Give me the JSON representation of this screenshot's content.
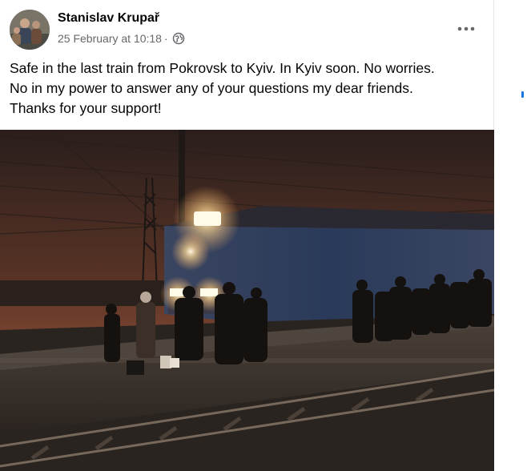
{
  "post": {
    "author": "Stanislav Krupař",
    "date": "25 February at 10:18",
    "separator": "·",
    "privacy_icon": "globe-icon",
    "more_icon": "more-options-icon",
    "text_lines": [
      "Safe in the last train from Pokrovsk to Kyiv. In Kyiv soon. No worries.",
      "No in my power to answer any of your questions my dear friends.",
      "Thanks for your support!"
    ]
  },
  "colors": {
    "author": "#050505",
    "meta": "#65676b",
    "accent": "#1b74e4"
  }
}
